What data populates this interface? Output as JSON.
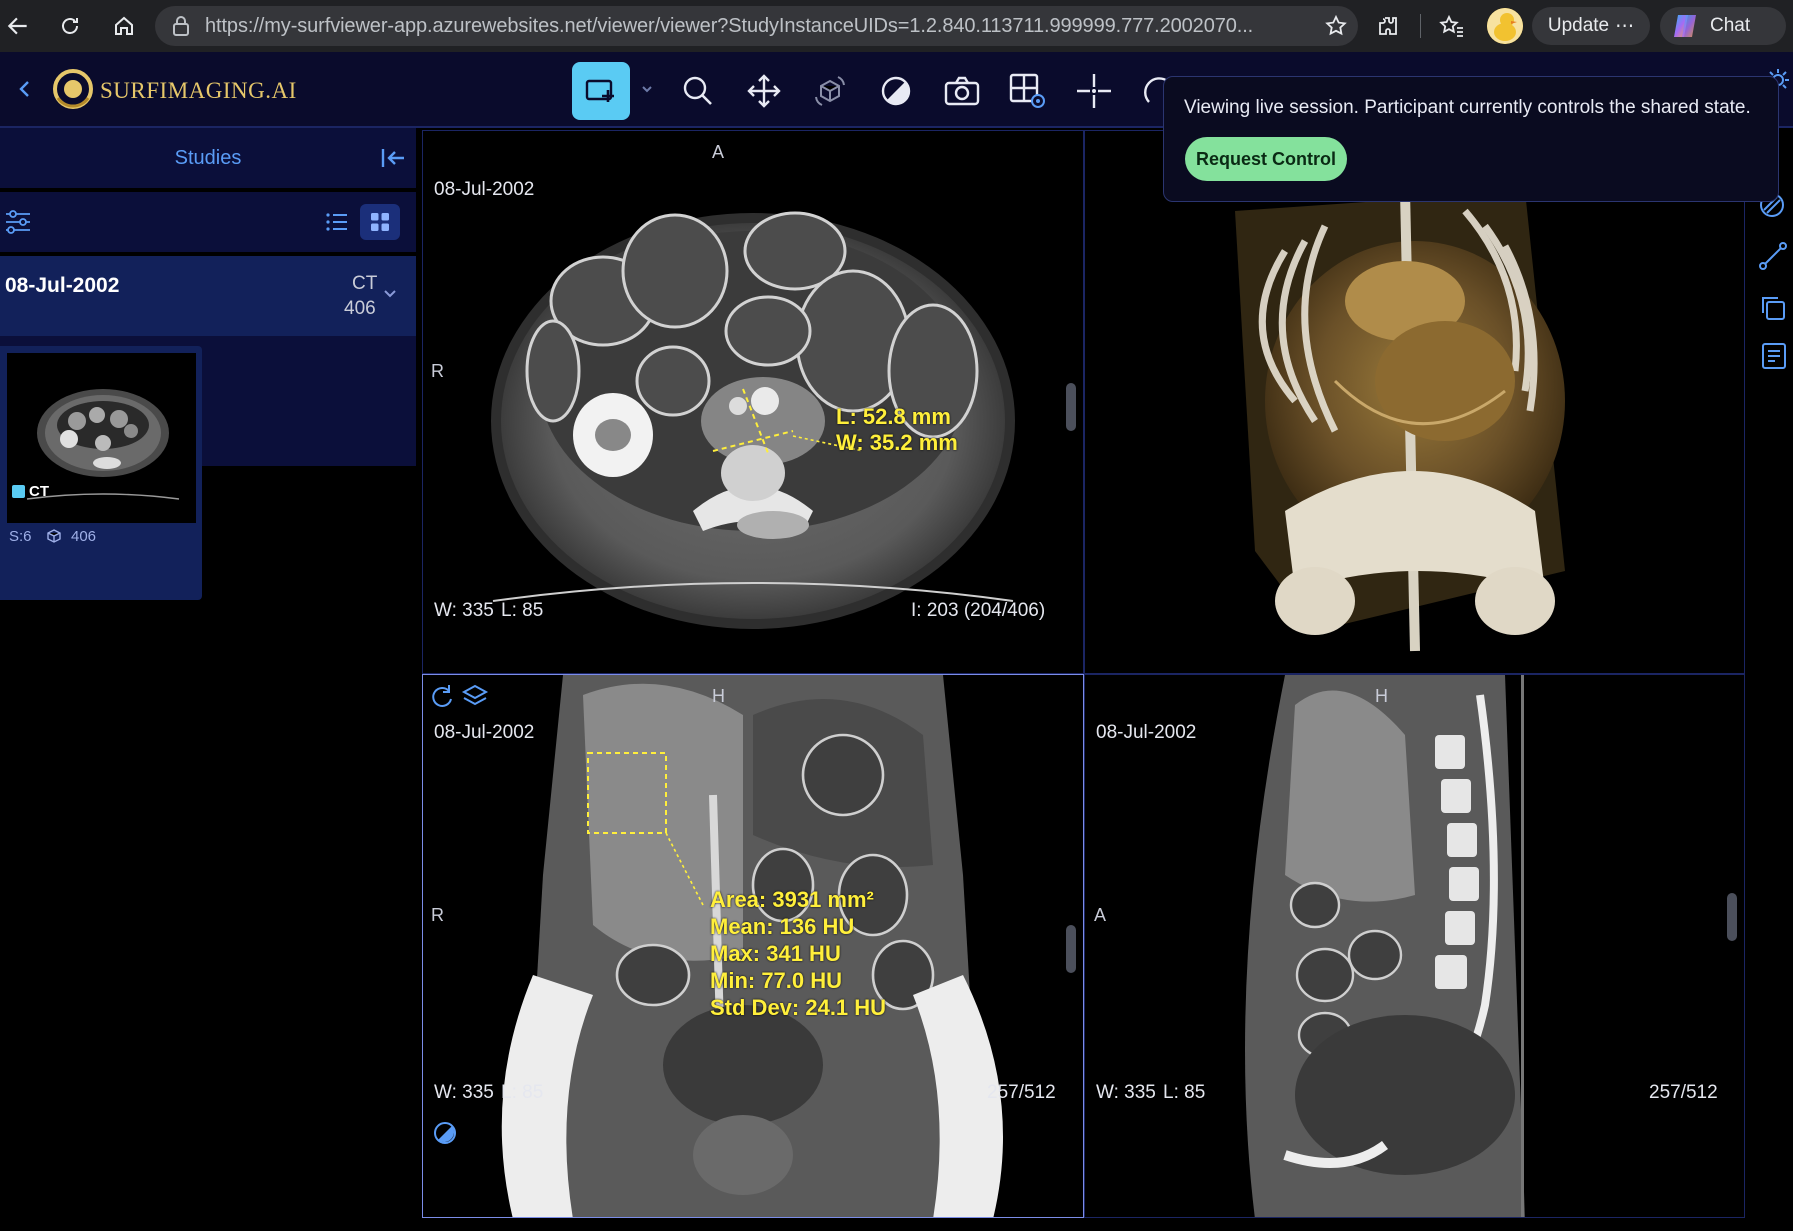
{
  "browser": {
    "url": "https://my-surfviewer-app.azurewebsites.net/viewer/viewer?StudyInstanceUIDs=1.2.840.113711.999999.777.2002070...",
    "update_label": "Update",
    "chat_label": "Chat",
    "icons": [
      "back-icon",
      "reload-icon",
      "home-icon",
      "lock-icon",
      "star-icon",
      "extensions-icon",
      "favorites-icon",
      "profile-avatar",
      "more-icon",
      "copilot-icon"
    ]
  },
  "header": {
    "brand": "SURFIMAGING.AI",
    "tools": [
      "measurement-tool",
      "zoom-tool",
      "pan-tool",
      "rotate-3d-tool",
      "window-level-tool",
      "capture-tool",
      "layout-tool",
      "crosshair-tool",
      "more-tool"
    ],
    "active_tool": "measurement-tool",
    "accent": "#5acbf3"
  },
  "toast": {
    "message": "Viewing live session. Participant currently controls the shared state.",
    "button": "Request Control",
    "button_color": "#84e19c"
  },
  "left_panel": {
    "title": "Studies",
    "study": {
      "date": "08-Jul-2002",
      "modality": "CT",
      "count": "406"
    },
    "series": {
      "modality": "CT",
      "series_label": "S:6",
      "instances": "406"
    }
  },
  "viewports": {
    "axial": {
      "top_label": "A",
      "left_label": "R",
      "date": "08-Jul-2002",
      "w": "W: 335",
      "l": "L: 85",
      "index": "I: 203 (204/406)",
      "measure_l": "L: 52.8 mm",
      "measure_w": "W: 35.2 mm"
    },
    "volume": {},
    "coronal": {
      "top_label": "H",
      "left_label": "R",
      "date": "08-Jul-2002",
      "w": "W: 335",
      "l": "L: 85",
      "slice": "257/512",
      "area": "Area: 3931 mm²",
      "mean": "Mean: 136 HU",
      "max": "Max: 341 HU",
      "min": "Min: 77.0 HU",
      "std": "Std Dev: 24.1 HU"
    },
    "sagittal": {
      "top_label": "H",
      "left_label": "A",
      "date": "08-Jul-2002",
      "w": "W: 335",
      "l": "L: 85",
      "slice": "257/512"
    }
  }
}
